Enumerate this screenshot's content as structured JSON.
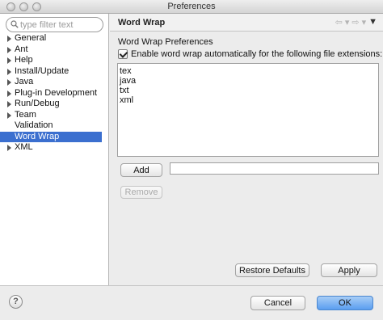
{
  "window": {
    "title": "Preferences"
  },
  "filter": {
    "placeholder": "type filter text",
    "value": ""
  },
  "tree": {
    "items": [
      {
        "label": "General",
        "expandable": true
      },
      {
        "label": "Ant",
        "expandable": true
      },
      {
        "label": "Help",
        "expandable": true
      },
      {
        "label": "Install/Update",
        "expandable": true
      },
      {
        "label": "Java",
        "expandable": true
      },
      {
        "label": "Plug-in Development",
        "expandable": true
      },
      {
        "label": "Run/Debug",
        "expandable": true
      },
      {
        "label": "Team",
        "expandable": true
      },
      {
        "label": "Validation",
        "expandable": false
      },
      {
        "label": "Word Wrap",
        "expandable": false,
        "selected": true
      },
      {
        "label": "XML",
        "expandable": true
      }
    ]
  },
  "page": {
    "title": "Word Wrap",
    "section_label": "Word Wrap Preferences",
    "checkbox_label": "Enable word wrap automatically for the following file extensions:",
    "checkbox_checked": true,
    "extensions": [
      "tex",
      "java",
      "txt",
      "xml"
    ],
    "add_label": "Add",
    "add_field_value": "",
    "remove_label": "Remove",
    "restore_defaults_label": "Restore Defaults",
    "apply_label": "Apply"
  },
  "footer": {
    "cancel_label": "Cancel",
    "ok_label": "OK",
    "help_glyph": "?"
  },
  "colors": {
    "selection": "#3b6fcf",
    "ok_button": "#5a9ef0"
  }
}
